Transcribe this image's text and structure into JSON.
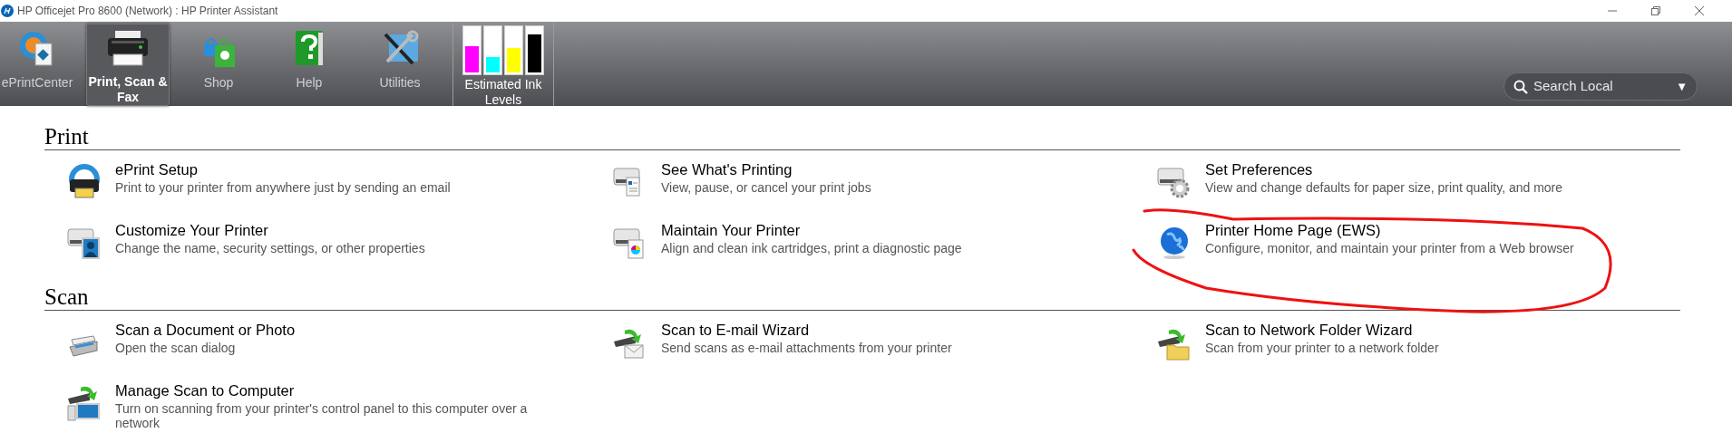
{
  "window": {
    "title": "HP Officejet Pro 8600 (Network) : HP Printer Assistant"
  },
  "toolbar": {
    "tabs": [
      {
        "label": "ePrintCenter",
        "selected": false
      },
      {
        "label": "Print, Scan & Fax",
        "selected": true
      },
      {
        "label": "Shop",
        "selected": false
      },
      {
        "label": "Help",
        "selected": false
      },
      {
        "label": "Utilities",
        "selected": false
      }
    ],
    "ink": {
      "label": "Estimated Ink Levels",
      "cartridges": [
        {
          "color": "#ff00ff",
          "level": 0.6
        },
        {
          "color": "#00ffff",
          "level": 0.35
        },
        {
          "color": "#ffff00",
          "level": 0.55
        },
        {
          "color": "#000000",
          "level": 0.85
        }
      ]
    },
    "search": {
      "placeholder": "Search Local",
      "dropdown": "▼"
    }
  },
  "sections": [
    {
      "title": "Print",
      "items": [
        {
          "title": "ePrint Setup",
          "description": "Print to your printer from anywhere just by sending an email"
        },
        {
          "title": "See What's Printing",
          "description": "View, pause, or cancel your print jobs"
        },
        {
          "title": "Set Preferences",
          "description": "View and change defaults for paper size, print quality, and more"
        },
        {
          "title": "Customize Your Printer",
          "description": "Change the name, security settings, or other properties"
        },
        {
          "title": "Maintain Your Printer",
          "description": "Align and clean ink cartridges, print a diagnostic page"
        },
        {
          "title": "Printer Home Page (EWS)",
          "description": "Configure, monitor, and maintain your printer from a Web browser"
        }
      ]
    },
    {
      "title": "Scan",
      "items": [
        {
          "title": "Scan a Document or Photo",
          "description": "Open the scan dialog"
        },
        {
          "title": "Scan to E-mail Wizard",
          "description": "Send scans as e-mail attachments from your printer"
        },
        {
          "title": "Scan to Network Folder Wizard",
          "description": "Scan from your printer to a network folder"
        },
        {
          "title": "Manage Scan to Computer",
          "description": "Turn on scanning from your printer's control panel to this computer over a network"
        }
      ]
    }
  ],
  "annotation": {
    "kind": "freehand_loop"
  }
}
